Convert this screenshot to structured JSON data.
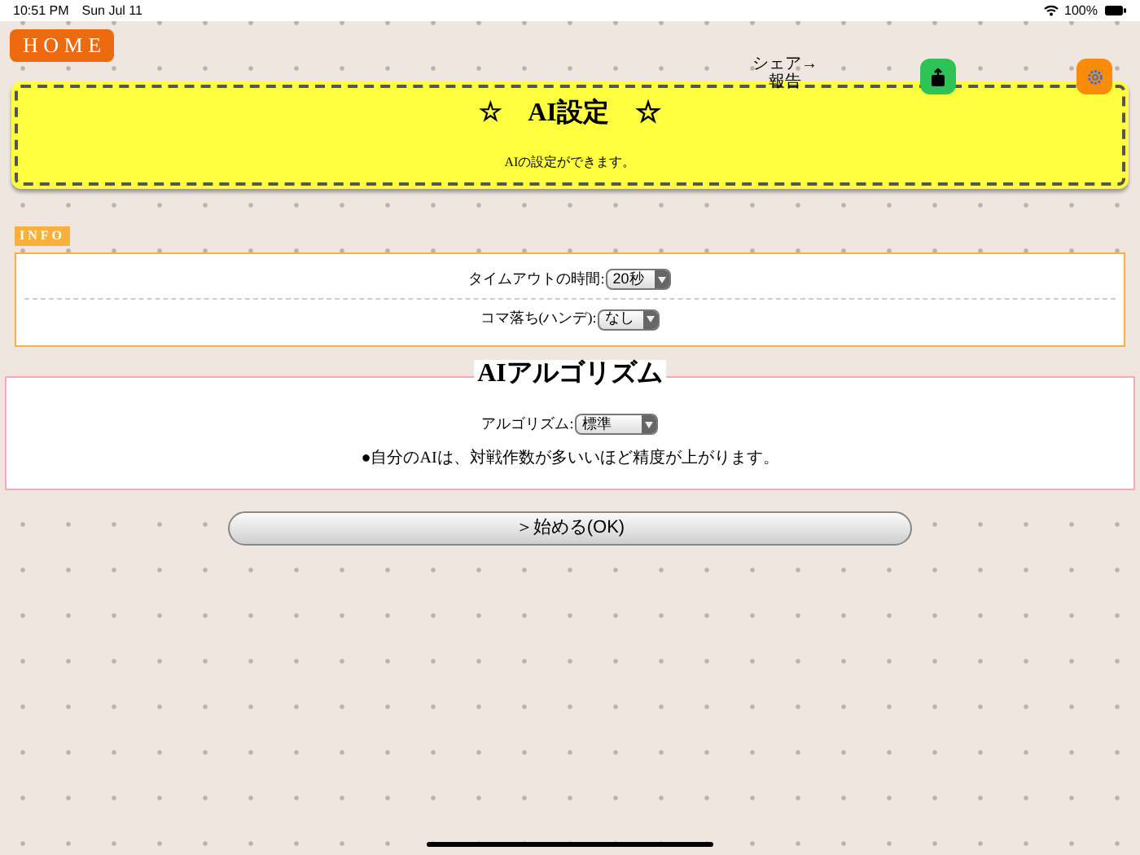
{
  "status_bar": {
    "time": "10:51 PM",
    "date": "Sun Jul 11",
    "battery": "100%"
  },
  "home_button": "H O M E",
  "share_label": [
    "シェア→",
    "報告"
  ],
  "banner": {
    "title": "☆　AI設定　☆",
    "subtitle": "AIの設定ができます。"
  },
  "info": {
    "tab": "INFO",
    "rows": [
      {
        "label": "タイムアウトの時間:",
        "value": "20秒"
      },
      {
        "label": "コマ落ち(ハンデ):",
        "value": "なし"
      }
    ]
  },
  "algorithm": {
    "title": "AIアルゴリズム",
    "label": "アルゴリズム:",
    "value": "標準",
    "note": "●自分のAIは、対戦作数が多いいほど精度が上がります。"
  },
  "start_button": "＞始める(OK)"
}
